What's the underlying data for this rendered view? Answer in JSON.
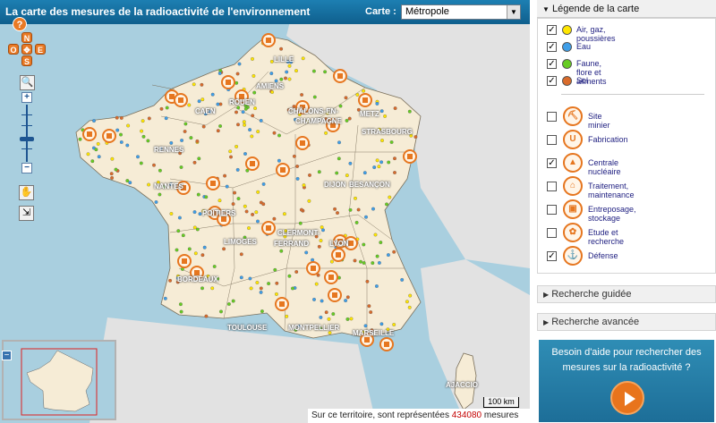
{
  "map_header": {
    "title": "La carte des mesures de la radioactivité de l'environnement",
    "carte_label": "Carte :",
    "carte_selected": "Métropole"
  },
  "navigation": {
    "help": "?",
    "north": "N",
    "west": "O",
    "east": "E",
    "south": "S",
    "zoom_in": "+",
    "zoom_out": "−"
  },
  "map": {
    "city_labels": [
      "LILLE",
      "AMIENS",
      "ROUEN",
      "CAEN",
      "CHÂLONS-EN-",
      "CHAMPAGNE",
      "METZ",
      "STRASBOURG",
      "RENNES",
      "DIJON",
      "BESANÇON",
      "NANTES",
      "POITIERS",
      "LIMOGES",
      "CLERMONT-",
      "FERRAND",
      "LYON",
      "BORDEAUX",
      "TOULOUSE",
      "MONTPELLIER",
      "MARSEILLE",
      "AJACCIO"
    ],
    "scale": "100 km",
    "status_prefix": "Sur ce territoire, sont représentées",
    "status_count": "434080",
    "status_suffix": "mesures",
    "colors": {
      "sea": "#a9cfdf",
      "land": "#f6ecd6",
      "foreign": "#e2e2e2",
      "site": "#e6761f"
    }
  },
  "legend": {
    "header": "Légende de la carte",
    "media": [
      {
        "label": "Air, gaz, poussières",
        "color": "#ffe600",
        "checked": "✓"
      },
      {
        "label": "Eau",
        "color": "#3e9ee8",
        "checked": "✓"
      },
      {
        "label": "Faune, flore et aliments",
        "color": "#66cc22",
        "checked": "✓"
      },
      {
        "label": "Sol",
        "color": "#d96b2b",
        "checked": "✓"
      }
    ],
    "sites": [
      {
        "label": "Site minier",
        "icon": "mine-icon",
        "glyph": "⛏",
        "checked": ""
      },
      {
        "label": "Fabrication",
        "icon": "factory-icon",
        "glyph": "U",
        "checked": ""
      },
      {
        "label": "Centrale nucléaire",
        "icon": "nuclear-plant-icon",
        "glyph": "▲",
        "checked": "✓"
      },
      {
        "label": "Traitement, maintenance",
        "icon": "treatment-icon",
        "glyph": "⌂",
        "checked": ""
      },
      {
        "label": "Entreposage, stockage",
        "icon": "storage-icon",
        "glyph": "▣",
        "checked": ""
      },
      {
        "label": "Etude et recherche",
        "icon": "research-icon",
        "glyph": "✿",
        "checked": ""
      },
      {
        "label": "Défense",
        "icon": "anchor-icon",
        "glyph": "⚓",
        "checked": "✓"
      }
    ]
  },
  "search": {
    "guided": "Recherche guidée",
    "advanced": "Recherche avancée"
  },
  "help_box": {
    "text": "Besoin d'aide pour rechercher des mesures sur la radioactivité ?"
  }
}
